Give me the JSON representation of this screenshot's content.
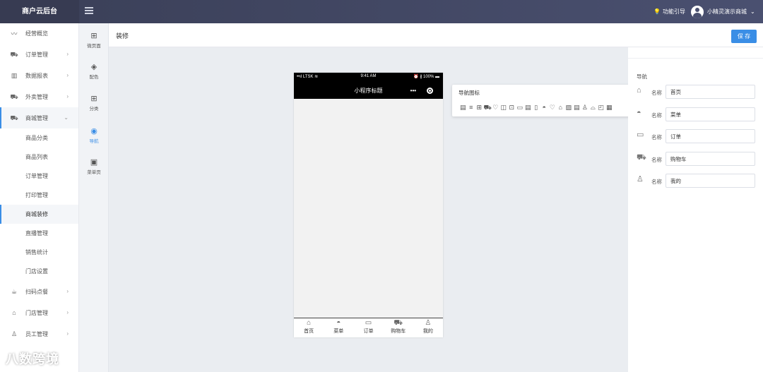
{
  "topbar": {
    "brand": "商户云后台",
    "guide_label": "功能引导",
    "user_name": "小精灵演示商城"
  },
  "sidebar": {
    "items": [
      {
        "label": "经营概览",
        "icon": "trend-icon",
        "glyph": "〰",
        "arrow": ""
      },
      {
        "label": "订单管理",
        "icon": "cart-icon",
        "glyph": "🛒",
        "arrow": "›"
      },
      {
        "label": "数据报表",
        "icon": "bar-chart-icon",
        "glyph": "▥",
        "arrow": "›"
      },
      {
        "label": "外卖管理",
        "icon": "cart-icon",
        "glyph": "🛒",
        "arrow": "›"
      },
      {
        "label": "商城管理",
        "icon": "cart-icon",
        "glyph": "🛒",
        "arrow": "⌄"
      }
    ],
    "sub_items": [
      "商品分类",
      "商品列表",
      "订单管理",
      "打印管理",
      "商城装修",
      "直播管理",
      "销售统计",
      "门店设置"
    ],
    "active_sub": "商城装修",
    "bottom_items": [
      {
        "label": "扫码点餐",
        "icon": "cup-icon",
        "glyph": "☕",
        "arrow": "›"
      },
      {
        "label": "门店管理",
        "icon": "home-icon",
        "glyph": "⌂",
        "arrow": "›"
      },
      {
        "label": "员工管理",
        "icon": "person-icon",
        "glyph": "♙",
        "arrow": "›"
      }
    ]
  },
  "tools": [
    {
      "label": "微页面",
      "icon": "grid-icon",
      "glyph": "⊞"
    },
    {
      "label": "配色",
      "icon": "paint-bucket-icon",
      "glyph": "◈"
    },
    {
      "label": "分类",
      "icon": "grid-icon",
      "glyph": "⊞"
    },
    {
      "label": "导航",
      "icon": "compass-icon",
      "glyph": "◉"
    },
    {
      "label": "菜单页",
      "icon": "bag-icon",
      "glyph": "▣"
    }
  ],
  "page": {
    "title": "装修",
    "save_label": "保 存"
  },
  "phone": {
    "carrier": "••ıl LTSK ≋",
    "time": "9:41 AM",
    "battery": "⏰ ∦ 100% ▬",
    "title": "小程序标题",
    "tabs": [
      {
        "label": "首页",
        "icon": "home-icon",
        "glyph": "⌂"
      },
      {
        "label": "菜单",
        "icon": "burger-icon",
        "glyph": "◓"
      },
      {
        "label": "订单",
        "icon": "calendar-icon",
        "glyph": "▭"
      },
      {
        "label": "购物车",
        "icon": "cart-icon",
        "glyph": "🛒"
      },
      {
        "label": "我的",
        "icon": "person-icon",
        "glyph": "♙"
      }
    ]
  },
  "popover": {
    "title": "导航图标",
    "icons": [
      "▤",
      "≡",
      "⊞",
      "⛟",
      "♡",
      "◫",
      "⊡",
      "▭",
      "▤",
      "▯",
      "◓",
      "♡",
      "⌂",
      "▨",
      "▤",
      "♙",
      "⌓",
      "◰",
      "▦"
    ]
  },
  "panel": {
    "section": "导航",
    "name_label": "名称",
    "rows": [
      {
        "icon": "home-icon",
        "glyph": "⌂",
        "value": "首页"
      },
      {
        "icon": "burger-icon",
        "glyph": "◓",
        "value": "菜单"
      },
      {
        "icon": "calendar-icon",
        "glyph": "▭",
        "value": "订单"
      },
      {
        "icon": "cart-icon",
        "glyph": "🛒",
        "value": "购物车"
      },
      {
        "icon": "person-icon",
        "glyph": "♙",
        "value": "我的"
      }
    ]
  },
  "watermark": "八数跨境",
  "colors": {
    "accent": "#3a8ee6",
    "topbar": "#3f445e",
    "phone_header": "#000000"
  }
}
